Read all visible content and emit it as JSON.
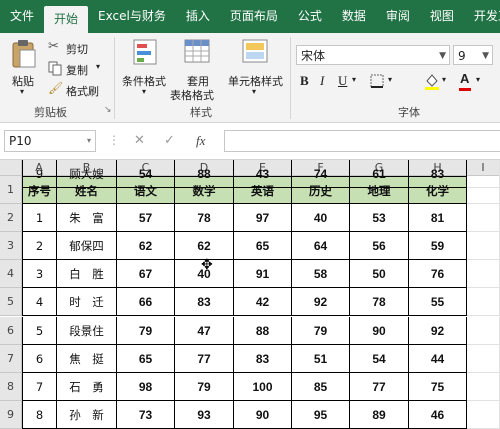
{
  "ribbon": {
    "tabs": [
      "文件",
      "开始",
      "Excel与财务",
      "插入",
      "页面布局",
      "公式",
      "数据",
      "审阅",
      "视图",
      "开发工具"
    ],
    "active_tab": 1,
    "clipboard": {
      "cut": "剪切",
      "copy": "复制",
      "paste": "粘贴",
      "format_painter": "格式刷",
      "group": "剪贴板"
    },
    "styles": {
      "conditional": "条件格式",
      "apply1": "套用",
      "apply2": "表格格式",
      "cellstyle": "单元格样式",
      "group": "样式"
    },
    "font": {
      "name": "宋体",
      "size": "9",
      "group": "字体"
    }
  },
  "formula_bar": {
    "name_box": "P10",
    "cancel": "✕",
    "enter": "✓",
    "fx": "fx",
    "formula": ""
  },
  "columns": [
    "A",
    "B",
    "C",
    "D",
    "E",
    "F",
    "G",
    "H",
    "I"
  ],
  "rows": [
    "1",
    "2",
    "3",
    "4",
    "5",
    "6",
    "7",
    "8",
    "9"
  ],
  "table": {
    "headers": [
      "序号",
      "姓名",
      "语文",
      "数学",
      "英语",
      "历史",
      "地理",
      "化学"
    ],
    "data": [
      [
        "1",
        "朱　富",
        "57",
        "78",
        "97",
        "40",
        "53",
        "81"
      ],
      [
        "2",
        "郁保四",
        "62",
        "62",
        "65",
        "64",
        "56",
        "59"
      ],
      [
        "3",
        "白　胜",
        "67",
        "40",
        "91",
        "58",
        "50",
        "76"
      ],
      [
        "4",
        "时　迁",
        "66",
        "83",
        "42",
        "92",
        "78",
        "55"
      ],
      [
        "5",
        "段景住",
        "79",
        "47",
        "88",
        "79",
        "90",
        "92"
      ],
      [
        "6",
        "焦　挺",
        "65",
        "77",
        "83",
        "51",
        "54",
        "44"
      ],
      [
        "7",
        "石　勇",
        "98",
        "79",
        "100",
        "85",
        "77",
        "75"
      ],
      [
        "8",
        "孙　新",
        "73",
        "93",
        "90",
        "95",
        "89",
        "46"
      ],
      [
        "9",
        "顾大嫂",
        "54",
        "88",
        "43",
        "74",
        "61",
        "83"
      ]
    ]
  },
  "colors": {
    "ribbon_green": "#217346",
    "header_fill": "#c6e0b4"
  }
}
